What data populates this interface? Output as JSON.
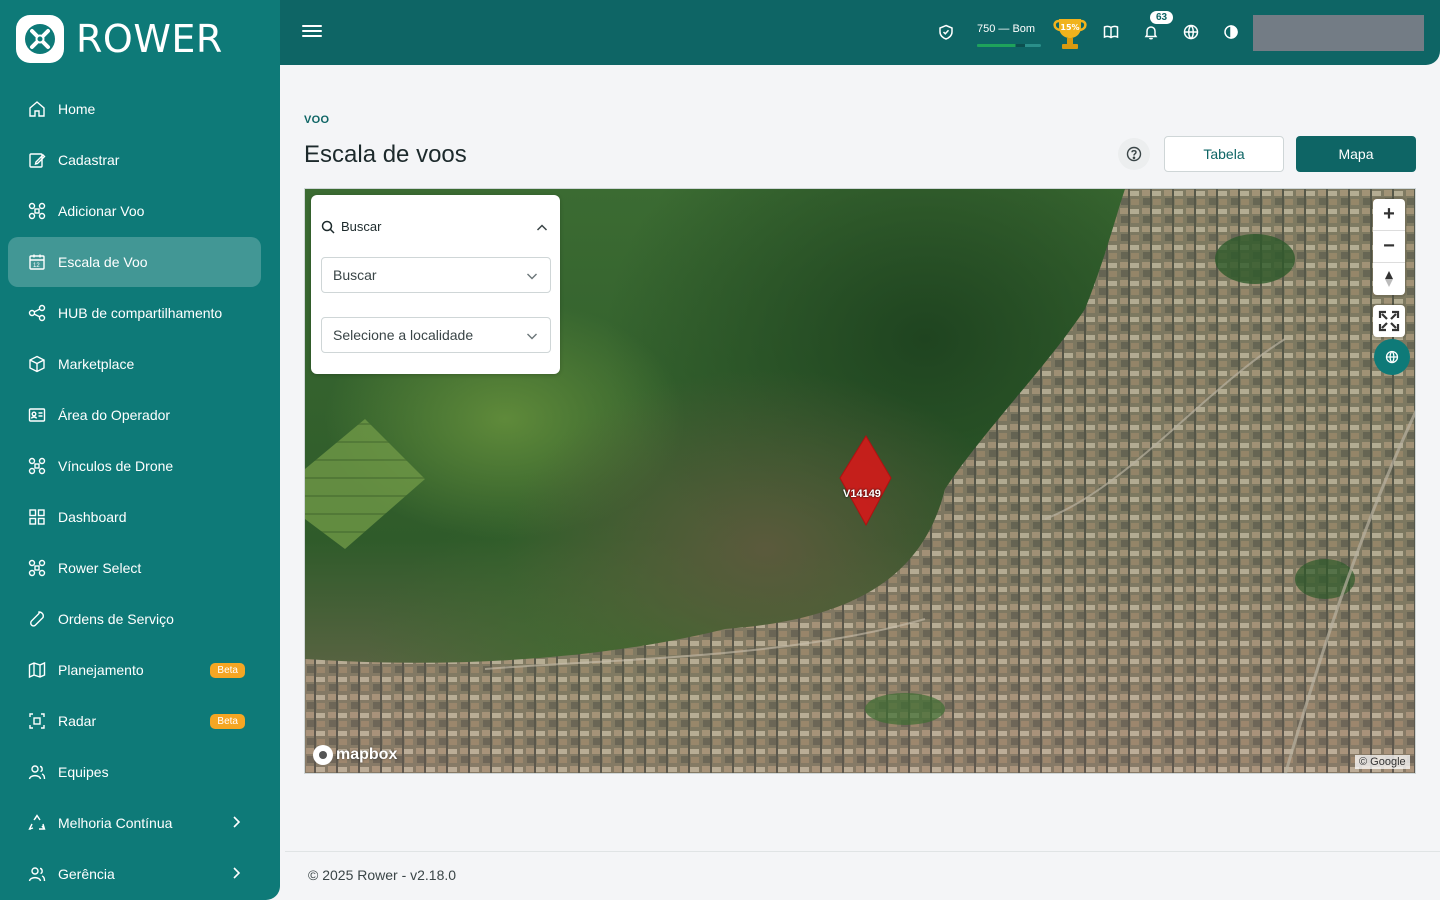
{
  "brand": {
    "name": "ROWER"
  },
  "sidebar": {
    "items": [
      {
        "label": "Home",
        "icon": "home-icon"
      },
      {
        "label": "Cadastrar",
        "icon": "edit-icon"
      },
      {
        "label": "Adicionar Voo",
        "icon": "drone-icon"
      },
      {
        "label": "Escala de Voo",
        "icon": "calendar-icon",
        "active": true
      },
      {
        "label": "HUB de compartilhamento",
        "icon": "share-icon"
      },
      {
        "label": "Marketplace",
        "icon": "box-icon"
      },
      {
        "label": "Área do Operador",
        "icon": "id-card-icon"
      },
      {
        "label": "Vínculos de Drone",
        "icon": "drone-icon"
      },
      {
        "label": "Dashboard",
        "icon": "grid-icon"
      },
      {
        "label": "Rower Select",
        "icon": "drone-icon"
      },
      {
        "label": "Ordens de Serviço",
        "icon": "wrench-icon"
      },
      {
        "label": "Planejamento",
        "icon": "map-icon",
        "badge": "Beta"
      },
      {
        "label": "Radar",
        "icon": "radar-icon",
        "badge": "Beta"
      },
      {
        "label": "Equipes",
        "icon": "team-icon"
      },
      {
        "label": "Melhoria Contínua",
        "icon": "recycle-icon",
        "chevron": true
      },
      {
        "label": "Gerência",
        "icon": "team-icon",
        "chevron": true
      }
    ]
  },
  "topbar": {
    "score_text": "750 — Bom",
    "score_level": 0.75,
    "trophy_text": "15%",
    "notifications_count": "63",
    "icons": [
      "menu-icon",
      "shield-check-icon",
      "trophy-icon",
      "book-icon",
      "bell-icon",
      "globe-icon",
      "contrast-icon"
    ]
  },
  "page": {
    "breadcrumb": "VOO",
    "title": "Escala de voos",
    "btn_tabela": "Tabela",
    "btn_mapa": "Mapa"
  },
  "map": {
    "search_title": "Buscar",
    "select_search": "Buscar",
    "select_location": "Selecione a localidade",
    "flight_label": "V14149",
    "zoom_in": "+",
    "zoom_out": "−",
    "attribution_brand": "mapbox",
    "attribution_google": "© Google",
    "flight_color": "#d41a1a"
  },
  "footer": {
    "text": "© 2025 Rower - v2.18.0"
  }
}
